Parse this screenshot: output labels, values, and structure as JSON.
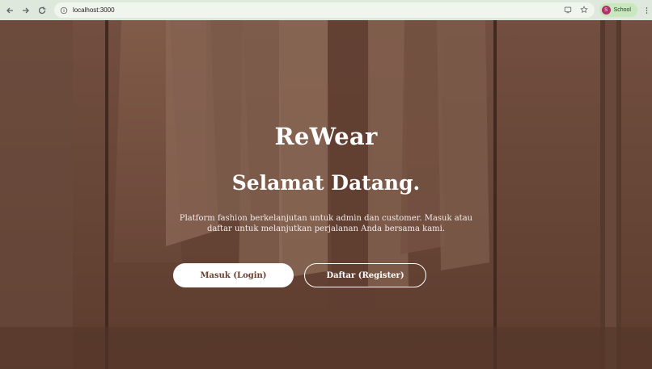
{
  "browser": {
    "url": "localhost:3000",
    "profile_initial": "S",
    "profile_label": "School"
  },
  "hero": {
    "brand": "ReWear",
    "headline": "Selamat Datang.",
    "tagline": "Platform fashion berkelanjutan untuk admin dan customer. Masuk atau daftar untuk melanjutkan perjalanan Anda bersama kami.",
    "login_label": "Masuk (Login)",
    "register_label": "Daftar (Register)"
  },
  "colors": {
    "accent": "#6b3f2e",
    "background": "#6b4a3c"
  }
}
